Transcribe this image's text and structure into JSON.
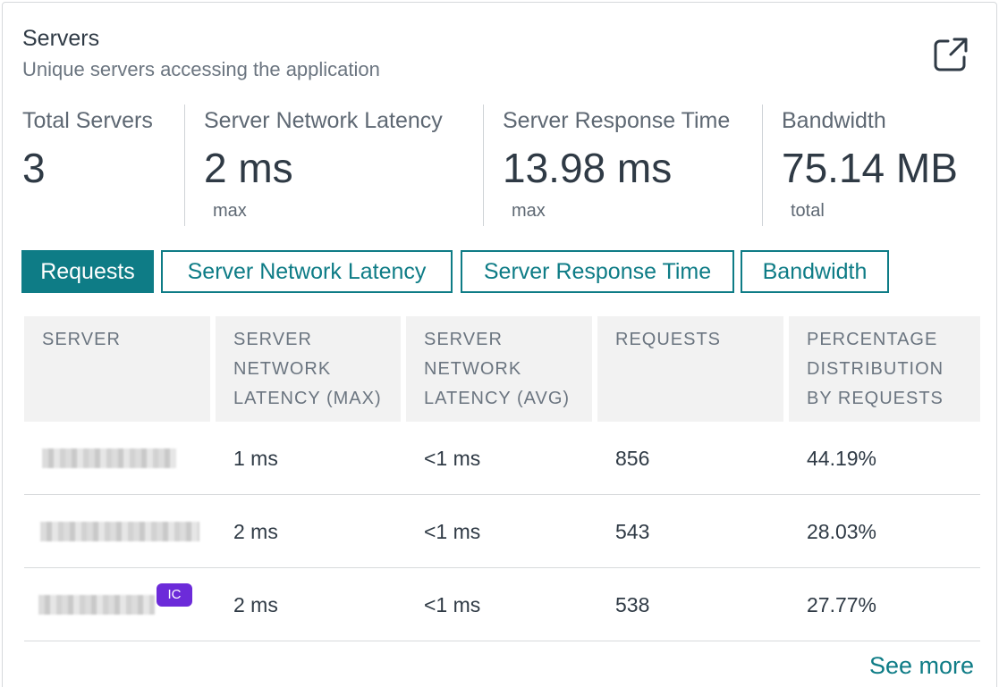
{
  "header": {
    "title": "Servers",
    "subtitle": "Unique servers accessing the application",
    "export_icon": "external-link-icon"
  },
  "metrics": [
    {
      "label": "Total Servers",
      "value": "3",
      "sub": ""
    },
    {
      "label": "Server Network Latency",
      "value": "2 ms",
      "sub": "max"
    },
    {
      "label": "Server Response Time",
      "value": "13.98 ms",
      "sub": "max"
    },
    {
      "label": "Bandwidth",
      "value": "75.14 MB",
      "sub": "total"
    }
  ],
  "tabs": [
    {
      "label": "Requests",
      "active": true
    },
    {
      "label": "Server Network Latency",
      "active": false
    },
    {
      "label": "Server Response Time",
      "active": false
    },
    {
      "label": "Bandwidth",
      "active": false
    }
  ],
  "table": {
    "columns": [
      "SERVER",
      "SERVER NETWORK LATENCY (MAX)",
      "SERVER NETWORK LATENCY (AVG)",
      "REQUESTS",
      "PERCENTAGE DISTRIBUTION BY REQUESTS"
    ],
    "rows": [
      {
        "latency_max": "1 ms",
        "latency_avg": "<1 ms",
        "requests": "856",
        "percentage": "44.19%",
        "badge": ""
      },
      {
        "latency_max": "2 ms",
        "latency_avg": "<1 ms",
        "requests": "543",
        "percentage": "28.03%",
        "badge": ""
      },
      {
        "latency_max": "2 ms",
        "latency_avg": "<1 ms",
        "requests": "538",
        "percentage": "27.77%",
        "badge": "IC"
      }
    ]
  },
  "footer": {
    "see_more": "See more"
  },
  "colors": {
    "accent": "#0e7c86",
    "badge": "#6c2bd9"
  }
}
